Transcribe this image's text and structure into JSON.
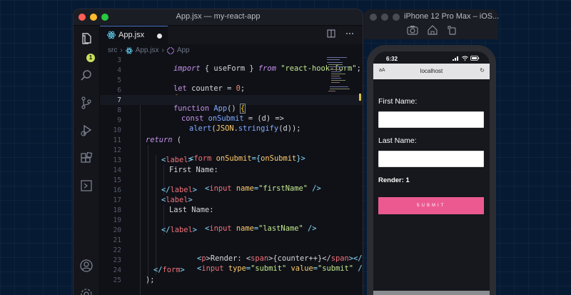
{
  "editor": {
    "window_title": "App.jsx — my-react-app",
    "tab_label": "App.jsx",
    "badge_count": "1",
    "breadcrumb": [
      "src",
      "App.jsx",
      "App"
    ],
    "colors": {
      "accent": "#4d78cc",
      "badge": "#c7e05a"
    }
  },
  "code_lines": [
    {
      "n": "3"
    },
    {
      "n": "4"
    },
    {
      "n": "5"
    },
    {
      "n": "6"
    },
    {
      "n": "7"
    },
    {
      "n": "8"
    },
    {
      "n": "9"
    },
    {
      "n": "10"
    },
    {
      "n": "11"
    },
    {
      "n": "12"
    },
    {
      "n": "13"
    },
    {
      "n": "14"
    },
    {
      "n": "15"
    },
    {
      "n": "16"
    },
    {
      "n": "17"
    },
    {
      "n": "18"
    },
    {
      "n": "19"
    },
    {
      "n": "20"
    },
    {
      "n": "21"
    },
    {
      "n": "22"
    },
    {
      "n": "23"
    },
    {
      "n": "24"
    },
    {
      "n": "25"
    }
  ],
  "code": {
    "l3": [
      "import",
      " { useForm } ",
      "from",
      " ",
      "\"react-hook-form\"",
      ";"
    ],
    "l4": [
      "let",
      " counter = ",
      "0",
      ";"
    ],
    "l7": [
      "function",
      " ",
      "App",
      "() ",
      "{"
    ],
    "l8": [
      "const",
      " ",
      "onSubmit",
      " = (d) =>"
    ],
    "l9": [
      "alert",
      "(",
      "JSON",
      ".",
      "stringify",
      "(d));"
    ],
    "l11": [
      "return",
      " ("
    ],
    "l12": [
      "<",
      "form",
      " ",
      "onSubmit",
      "={",
      "onSubmit",
      "}>"
    ],
    "l13": [
      "<",
      "label",
      ">"
    ],
    "l14": [
      "First Name:"
    ],
    "l15": [
      "<",
      "input",
      " ",
      "name",
      "=",
      "\"firstName\"",
      " />"
    ],
    "l16": [
      "</",
      "label",
      ">"
    ],
    "l17": [
      "<",
      "label",
      ">"
    ],
    "l18": [
      "Last Name:"
    ],
    "l19": [
      "<",
      "input",
      " ",
      "name",
      "=",
      "\"lastName\"",
      " />"
    ],
    "l20": [
      "</",
      "label",
      ">"
    ],
    "l22": [
      "<",
      "p",
      ">Render: <",
      "span",
      ">{counter++}</",
      "span",
      "></",
      "p",
      ">"
    ],
    "l23": [
      "<",
      "input",
      " ",
      "type",
      "=",
      "\"submit\"",
      " ",
      "value",
      "=",
      "\"submit\"",
      " />"
    ],
    "l24": [
      "</",
      "form",
      ">"
    ],
    "l25": [
      ");"
    ]
  },
  "simulator": {
    "title": "iPhone 12 Pro Max – iOS...",
    "time": "6:32",
    "url_aa": "aA",
    "url": "localhost",
    "first_name_label": "First Name:",
    "last_name_label": "Last Name:",
    "render_text": "Render: 1",
    "submit_label": "SUBMIT",
    "colors": {
      "submit": "#ec5990"
    }
  }
}
